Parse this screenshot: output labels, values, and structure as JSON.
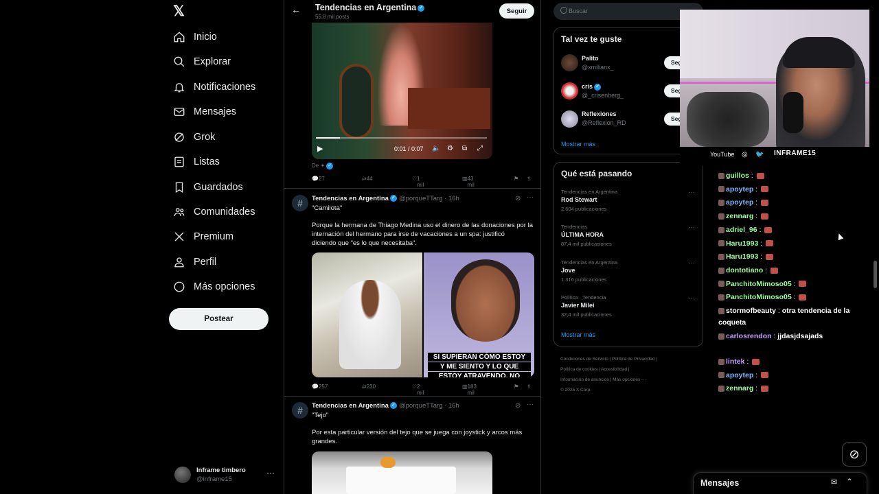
{
  "nav": {
    "logo": "𝕏",
    "items": [
      {
        "label": "Inicio",
        "icon": "home-icon"
      },
      {
        "label": "Explorar",
        "icon": "search-icon"
      },
      {
        "label": "Notificaciones",
        "icon": "bell-icon"
      },
      {
        "label": "Mensajes",
        "icon": "mail-icon"
      },
      {
        "label": "Grok",
        "icon": "grok-icon"
      },
      {
        "label": "Listas",
        "icon": "list-icon"
      },
      {
        "label": "Guardados",
        "icon": "bookmark-icon"
      },
      {
        "label": "Comunidades",
        "icon": "people-icon"
      },
      {
        "label": "Premium",
        "icon": "x-icon"
      },
      {
        "label": "Perfil",
        "icon": "person-icon"
      },
      {
        "label": "Más opciones",
        "icon": "more-circle-icon"
      }
    ],
    "post_label": "Postear",
    "account": {
      "name": "Inframe timbero",
      "handle": "@inframe15"
    }
  },
  "header": {
    "title": "Tendencias en Argentina",
    "subtitle": "55,8 mil posts",
    "follow_label": "Seguir"
  },
  "video": {
    "time": "0:01 / 0:07",
    "progress": 0.14
  },
  "tweet0": {
    "caption": "De ✦",
    "replies": "27",
    "reposts": "44",
    "likes": "1 mil",
    "views": "43 mil"
  },
  "tweet1": {
    "name": "Tendencias en Argentina",
    "meta": "@porqueTTarg · 16h",
    "title": "\"Camilota\"",
    "body_lines": [
      "Porque la hermana de Thiago Medina uso el dinero de las donaciones por la",
      "internación del hermano para irse de vacaciones a un spa: justificó",
      "diciendo que \"es lo que necesitaba\"."
    ],
    "overlay_lines": [
      "SI SUPIERAN CÓMO ESTOY",
      "Y ME SIENTO Y LO QUE",
      "ESTOY ATRAVENDO, NO TODO"
    ],
    "replies": "257",
    "reposts": "230",
    "likes": "2 mil",
    "views": "183 mil"
  },
  "tweet2": {
    "name": "Tendencias en Argentina",
    "meta": "@porqueTTarg · 16h",
    "title": "\"Tejo\"",
    "body_lines": [
      "Por esta particular versión del tejo que se juega con joystick y arcos más",
      "grandes."
    ]
  },
  "search": {
    "placeholder": "Buscar"
  },
  "suggestions": {
    "title": "Tal vez te guste",
    "items": [
      {
        "name": "Palito",
        "handle": "@xmilianx_",
        "button": "Seguir"
      },
      {
        "name": "cris",
        "handle": "@_crisenberg_",
        "button": "Seguir"
      },
      {
        "name": "Reflexiones",
        "handle": "@Reflexion_RD",
        "button": "Seguir"
      }
    ],
    "show_more": "Mostrar más"
  },
  "trends": {
    "title": "Qué está pasando",
    "items": [
      {
        "category": "Tendencias en Argentina",
        "name": "Rod Stewart",
        "count": "2.604 publicaciones"
      },
      {
        "category": "Tendencias",
        "name": "ÚLTIMA HORA",
        "count": "87,4 mil publicaciones"
      },
      {
        "category": "Tendencias en Argentina",
        "name": "Jove",
        "count": "1.316 publicaciones"
      },
      {
        "category": "Política · Tendencia",
        "name": "Javier Milei",
        "count": "32,4 mil publicaciones"
      }
    ],
    "show_more": "Mostrar más"
  },
  "footer": {
    "line1": "Condiciones de Servicio | Política de Privacidad |",
    "line2": "Política de cookies | Accesibilidad |",
    "line3": "Información de anuncios | Más opciones ···",
    "line4": "© 2025 X Corp."
  },
  "webcam": {
    "youtube": "YouTube",
    "brand": "INFRAME15"
  },
  "chat": [
    {
      "name": "guillos",
      "color": "#9aff9a",
      "text": ""
    },
    {
      "name": "apoytep",
      "color": "#7fb8ff",
      "text": ""
    },
    {
      "name": "apoytep",
      "color": "#7fb8ff",
      "text": ""
    },
    {
      "name": "zennarg",
      "color": "#9aff9a",
      "text": ""
    },
    {
      "name": "adriel_96",
      "color": "#9aff9a",
      "text": ""
    },
    {
      "name": "Haru1993",
      "color": "#9aff9a",
      "text": ""
    },
    {
      "name": "Haru1993",
      "color": "#9aff9a",
      "text": ""
    },
    {
      "name": "dontotiano",
      "color": "#9aff9a",
      "text": ""
    },
    {
      "name": "PanchitoMimoso05",
      "color": "#9aff9a",
      "text": ""
    },
    {
      "name": "PanchitoMimoso05",
      "color": "#9aff9a",
      "text": ""
    },
    {
      "name": "stormofbeauty",
      "color": "#ffffff",
      "text": "otra tendencia de la coqueta"
    },
    {
      "name": "carlosrendon",
      "color": "#c8a0ff",
      "text": "jjdasjdsajads"
    },
    {
      "name": "lintek",
      "color": "#c8a0ff",
      "text": ""
    },
    {
      "name": "apoytep",
      "color": "#7fb8ff",
      "text": ""
    },
    {
      "name": "zennarg",
      "color": "#9aff9a",
      "text": ""
    }
  ],
  "messages": {
    "title": "Mensajes"
  }
}
